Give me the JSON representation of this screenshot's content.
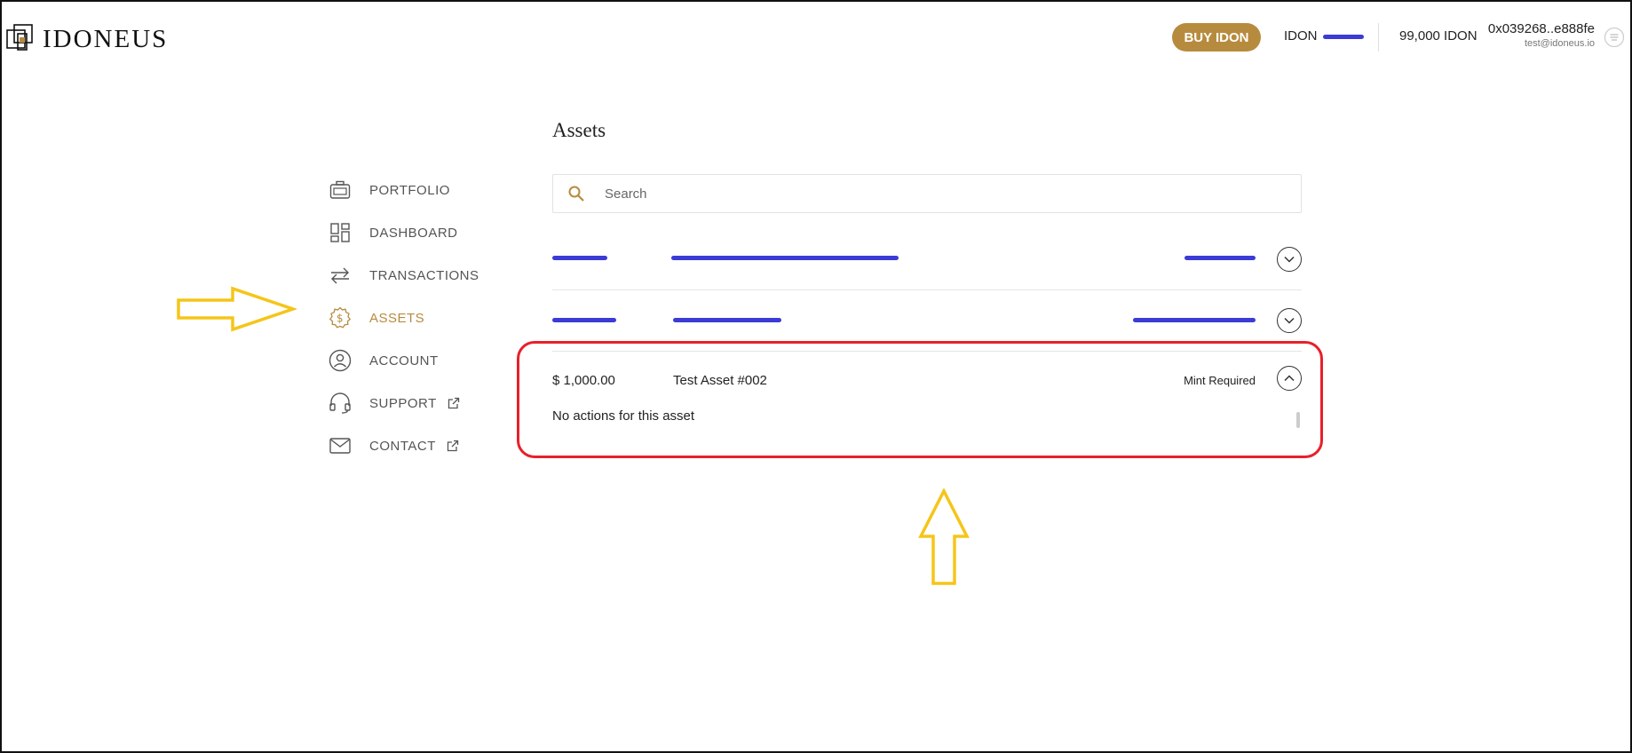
{
  "brand": {
    "name": "IDONEUS",
    "accent": "#b78b3e"
  },
  "header": {
    "buy_label": "BUY IDON",
    "idon_price_label": "IDON",
    "balance": "99,000 IDON",
    "wallet_address": "0x039268..e888fe",
    "wallet_email": "test@idoneus.io"
  },
  "sidebar": {
    "items": [
      {
        "label": "PORTFOLIO",
        "icon": "briefcase-icon",
        "active": false
      },
      {
        "label": "DASHBOARD",
        "icon": "dashboard-grid-icon",
        "active": false
      },
      {
        "label": "TRANSACTIONS",
        "icon": "swap-arrows-icon",
        "active": false
      },
      {
        "label": "ASSETS",
        "icon": "dollar-gear-icon",
        "active": true
      },
      {
        "label": "ACCOUNT",
        "icon": "user-circle-icon",
        "active": false
      },
      {
        "label": "SUPPORT",
        "icon": "headset-icon",
        "active": false,
        "external": true
      },
      {
        "label": "CONTACT",
        "icon": "envelope-icon",
        "active": false,
        "external": true
      }
    ]
  },
  "main": {
    "title": "Assets",
    "search_placeholder": "Search",
    "assets": [
      {
        "price": "",
        "name": "",
        "status": "",
        "expanded": false,
        "redacted": true
      },
      {
        "price": "",
        "name": "",
        "status": "",
        "expanded": false,
        "redacted": true
      },
      {
        "price": "$ 1,000.00",
        "name": "Test Asset #002",
        "status": "Mint Required",
        "expanded": true,
        "actions_text": "No actions for this asset"
      }
    ]
  },
  "annotations": {
    "highlight_color": "#e8202a",
    "arrow_color": "#f5c518",
    "redaction_color": "#3b3bd6"
  }
}
